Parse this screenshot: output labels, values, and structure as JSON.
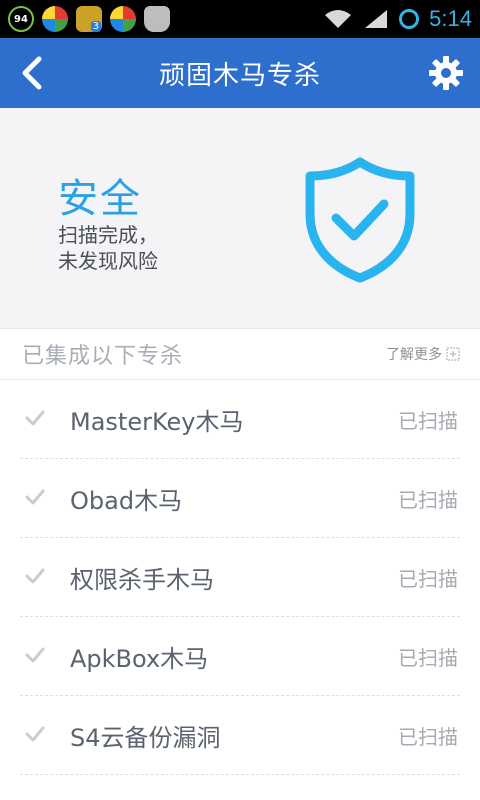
{
  "statusbar": {
    "badge_number": "94",
    "app_badge_count": "3",
    "time": "5:14",
    "colors": {
      "accent": "#31b5e6"
    },
    "icons": [
      "notification-94-icon",
      "app-icon",
      "app-icon-with-badge",
      "app-icon",
      "robot-icon",
      "wifi-icon",
      "signal-icon",
      "ring-icon"
    ]
  },
  "header": {
    "title": "顽固木马专杀",
    "back_icon": "chevron-left-icon",
    "settings_icon": "gear-icon",
    "background": "#2e6fcd"
  },
  "hero": {
    "status_title": "安全",
    "status_desc": "扫描完成，\n未发现风险",
    "status_color": "#2aa0e6",
    "shield_icon": "shield-check-icon"
  },
  "section": {
    "title": "已集成以下专杀",
    "learn_more": "了解更多"
  },
  "items": [
    {
      "name": "MasterKey木马",
      "status": "已扫描"
    },
    {
      "name": "Obad木马",
      "status": "已扫描"
    },
    {
      "name": "权限杀手木马",
      "status": "已扫描"
    },
    {
      "name": "ApkBox木马",
      "status": "已扫描"
    },
    {
      "name": "S4云备份漏洞",
      "status": "已扫描"
    }
  ]
}
